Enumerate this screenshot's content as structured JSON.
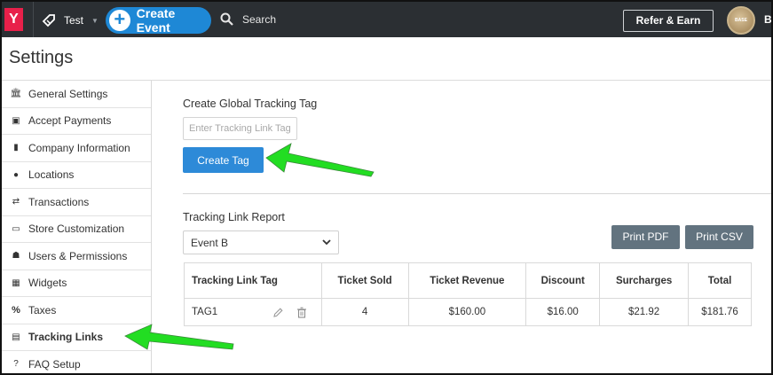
{
  "topbar": {
    "logo": "Y",
    "event_name": "Test",
    "create_event_label": "Create Event",
    "search_label": "Search",
    "refer_label": "Refer & Earn",
    "avatar_text": "BASE",
    "user_initial": "B"
  },
  "page": {
    "title": "Settings"
  },
  "sidebar": {
    "items": [
      {
        "label": "General Settings",
        "icon": "bank-icon"
      },
      {
        "label": "Accept Payments",
        "icon": "money-icon"
      },
      {
        "label": "Company Information",
        "icon": "building-icon"
      },
      {
        "label": "Locations",
        "icon": "map-marker-icon"
      },
      {
        "label": "Transactions",
        "icon": "exchange-icon"
      },
      {
        "label": "Store Customization",
        "icon": "desktop-icon"
      },
      {
        "label": "Users & Permissions",
        "icon": "users-icon"
      },
      {
        "label": "Widgets",
        "icon": "grid-icon"
      },
      {
        "label": "Taxes",
        "icon": "percent-icon"
      },
      {
        "label": "Tracking Links",
        "icon": "bookmark-icon",
        "active": true
      },
      {
        "label": "FAQ Setup",
        "icon": "question-circle-icon"
      }
    ]
  },
  "tracking": {
    "create_title": "Create Global Tracking Tag",
    "input_placeholder": "Enter Tracking Link Tag",
    "create_button": "Create Tag",
    "report_title": "Tracking Link Report",
    "event_selected": "Event B",
    "print_pdf": "Print PDF",
    "print_csv": "Print CSV",
    "columns": [
      "Tracking Link Tag",
      "Ticket Sold",
      "Ticket Revenue",
      "Discount",
      "Surcharges",
      "Total"
    ],
    "rows": [
      {
        "tag": "TAG1",
        "sold": "4",
        "revenue": "$160.00",
        "discount": "$16.00",
        "surcharges": "$21.92",
        "total": "$181.76"
      }
    ]
  },
  "colors": {
    "accent": "#1e88d6",
    "topbar": "#2b2f33",
    "logo": "#e8204a",
    "print_button": "#62737f",
    "annotation_arrow": "#22dd22"
  }
}
